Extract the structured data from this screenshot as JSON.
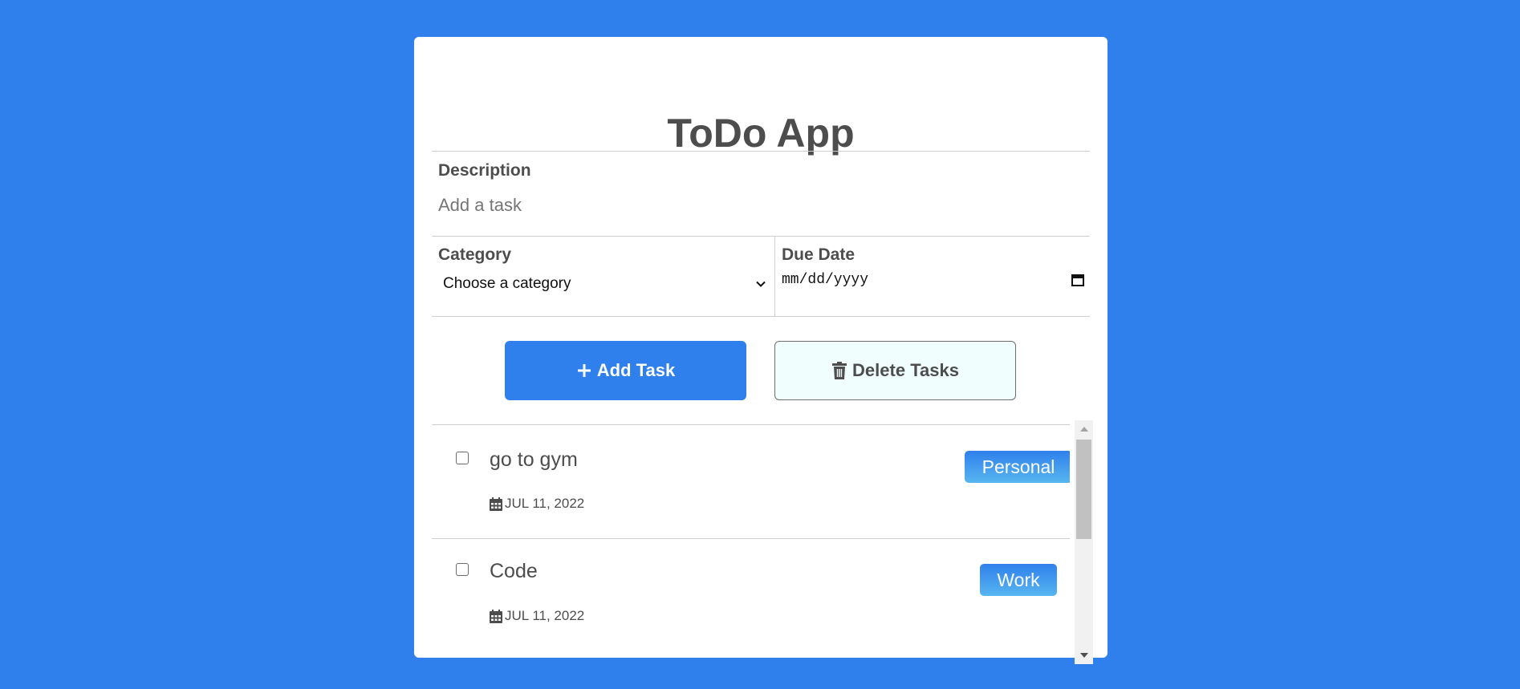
{
  "app": {
    "title": "ToDo App"
  },
  "form": {
    "description_label": "Description",
    "description_placeholder": "Add a task",
    "description_value": "",
    "category_label": "Category",
    "category_selected": "Choose a category",
    "due_date_label": "Due Date",
    "due_date_placeholder": "mm/dd/yyyy"
  },
  "buttons": {
    "add_label": "Add Task",
    "add_icon": "plus-icon",
    "delete_label": "Delete Tasks",
    "delete_icon": "trash-icon"
  },
  "tasks": [
    {
      "text": "go to gym",
      "date": "JUL 11, 2022",
      "category": "Personal",
      "checked": false
    },
    {
      "text": "Code",
      "date": "JUL 11, 2022",
      "category": "Work",
      "checked": false
    }
  ],
  "colors": {
    "background": "#2f80ec",
    "primary": "#2f80ec",
    "text": "#4d4d4d",
    "delete_button_bg": "#f0fffe",
    "badge_gradient_top": "#2f80ec",
    "badge_gradient_bottom": "#57b6f0"
  }
}
